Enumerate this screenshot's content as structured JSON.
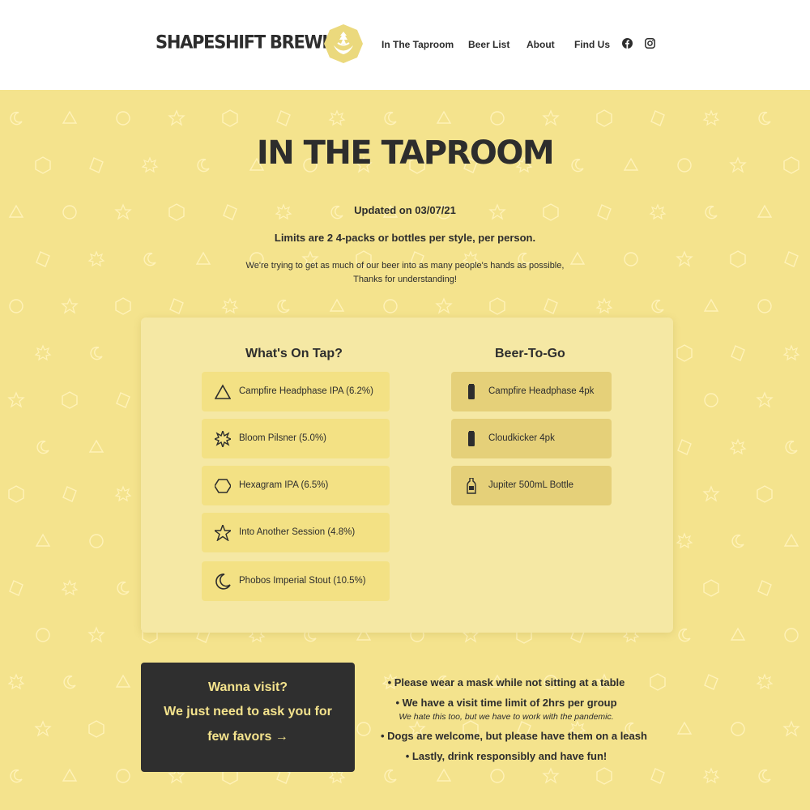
{
  "header": {
    "brand": "SHAPESHIFT BREWING",
    "nav": [
      "In The Taproom",
      "Beer List",
      "About",
      "Find Us"
    ],
    "social_icons": [
      "facebook-icon",
      "instagram-icon"
    ]
  },
  "page": {
    "title": "IN THE TAPROOM",
    "updated": "Updated on 03/07/21",
    "limits": "Limits are 2 4-packs or bottles per style, per person.",
    "note_line1": "We're trying to get as much of our beer into as many people's hands as possible,",
    "note_line2": "Thanks for understanding!"
  },
  "on_tap": {
    "title": "What's On Tap?",
    "items": [
      {
        "icon": "triangle-icon",
        "label": "Campfire Headphase IPA (6.2%)"
      },
      {
        "icon": "starburst-icon",
        "label": "Bloom Pilsner (5.0%)"
      },
      {
        "icon": "hexagon-icon",
        "label": "Hexagram IPA (6.5%)"
      },
      {
        "icon": "star-icon",
        "label": "Into Another Session (4.8%)"
      },
      {
        "icon": "moon-icon",
        "label": "Phobos Imperial Stout (10.5%)"
      }
    ]
  },
  "to_go": {
    "title": "Beer-To-Go",
    "items": [
      {
        "icon": "can-icon",
        "label": "Campfire Headphase 4pk"
      },
      {
        "icon": "can-icon",
        "label": "Cloudkicker 4pk"
      },
      {
        "icon": "bottle-icon",
        "label": "Jupiter 500mL Bottle"
      }
    ]
  },
  "visit": {
    "line1": "Wanna visit?",
    "line2": "We just need to ask you for",
    "line3": "few favors →"
  },
  "rules": {
    "mask": "• Please wear a mask while not sitting at a table",
    "time_limit": "• We have a visit time limit of 2hrs per group",
    "time_note": "We hate this too, but we have to work with the pandemic.",
    "dogs": "• Dogs are welcome, but please have them on a leash",
    "lastly": "• Lastly, drink responsibly and have fun!"
  },
  "colors": {
    "background": "#f4e38d",
    "panel": "#f5e8a4",
    "tap_item": "#f3e184",
    "togo_item": "#e5d079",
    "dark": "#2f2f2f"
  }
}
